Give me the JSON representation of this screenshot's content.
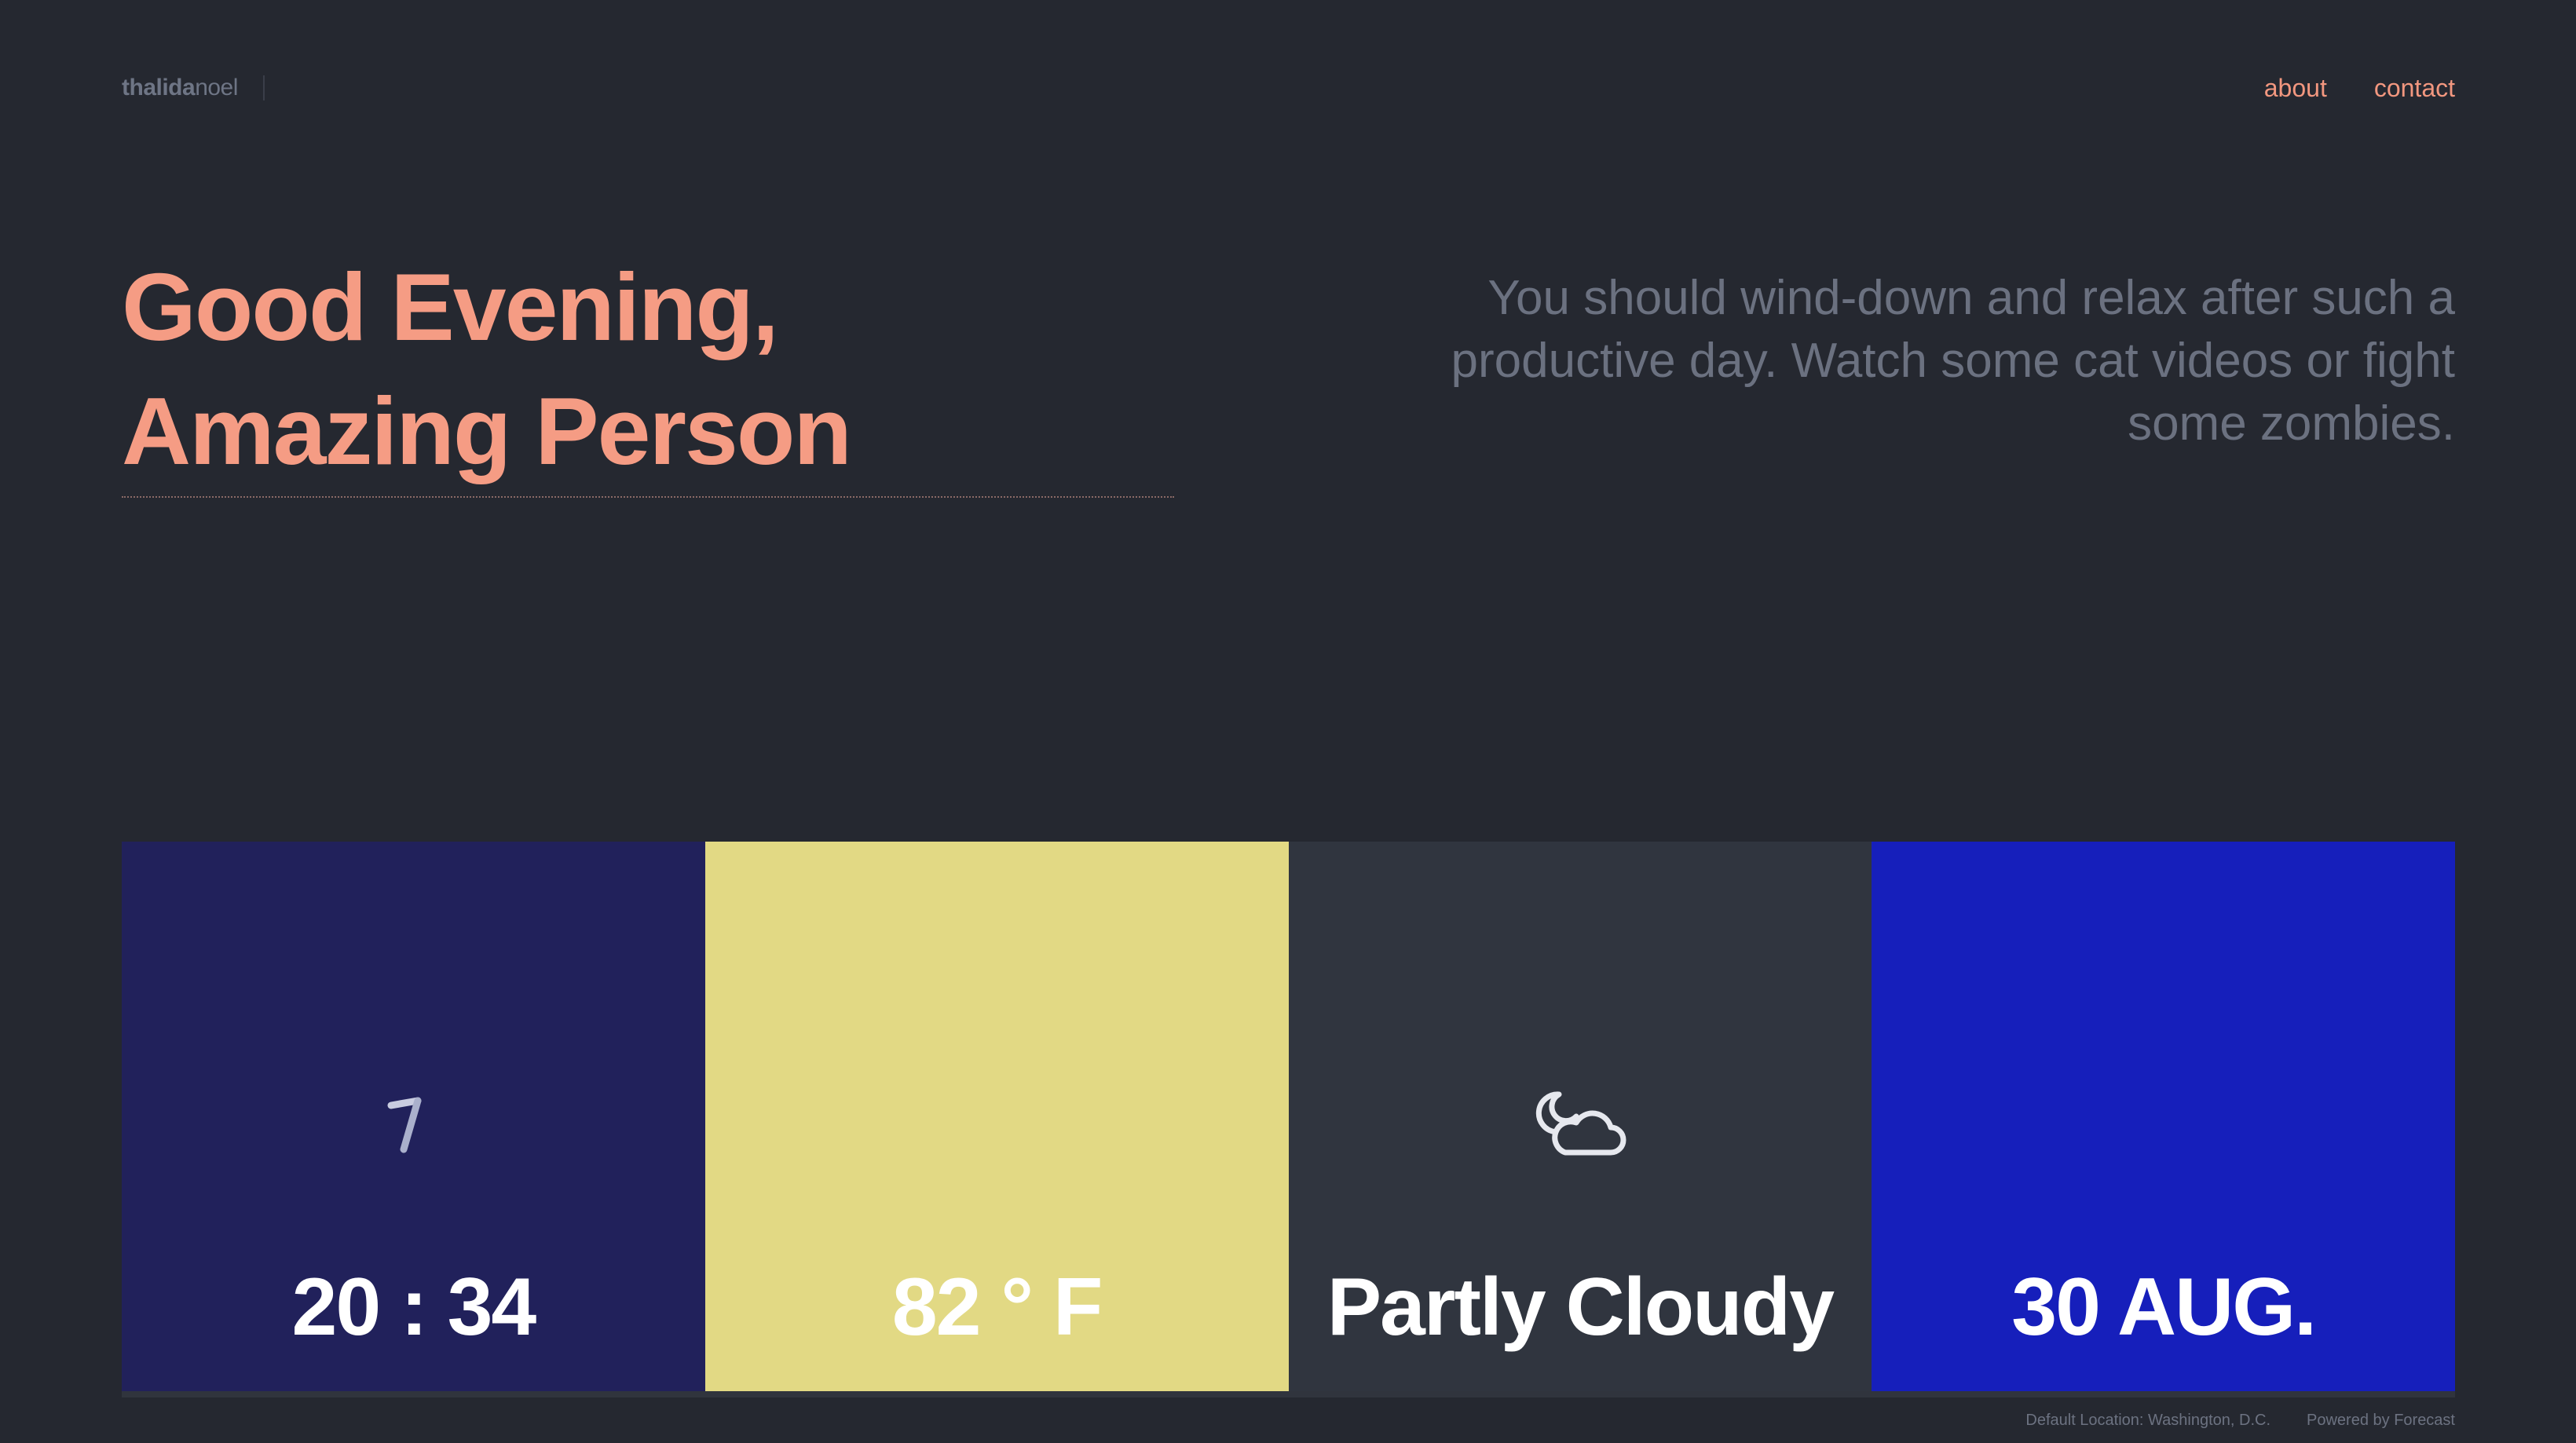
{
  "header": {
    "brand_bold": "thalida",
    "brand_light": "noel",
    "nav": [
      {
        "label": "about"
      },
      {
        "label": "contact"
      }
    ]
  },
  "greeting": {
    "line1": "Good Evening,",
    "line2": "Amazing Person"
  },
  "advice": "You should wind-down and relax after such a productive day. Watch some cat videos or fight some zombies.",
  "tiles": {
    "clock": {
      "value": "20 : 34",
      "icon": "clock-hands-icon",
      "color": "#21215b"
    },
    "temperature": {
      "value": "82 ° F",
      "color": "#e2d984"
    },
    "condition": {
      "value": "Partly Cloudy",
      "icon": "partly-cloudy-night-icon",
      "color": "#30353f"
    },
    "date": {
      "value": "30 AUG.",
      "color": "#161fbb"
    }
  },
  "footer": {
    "location": "Default Location: Washington, D.C.",
    "powered": "Powered by Forecast"
  },
  "colors": {
    "background": "#252830",
    "accent": "#f59c84",
    "muted_text": "#6b7180"
  }
}
